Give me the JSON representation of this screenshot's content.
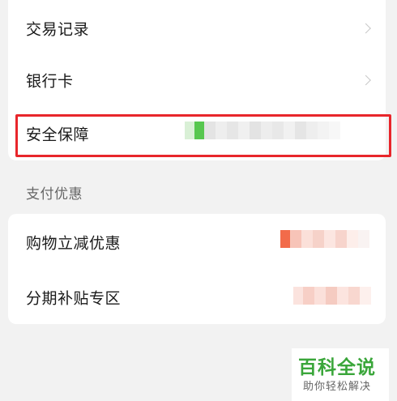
{
  "wallet": {
    "rows": [
      {
        "label": "交易记录"
      },
      {
        "label": "银行卡"
      },
      {
        "label": "安全保障"
      }
    ],
    "section_title": "支付优惠",
    "promo_rows": [
      {
        "label": "购物立减优惠"
      },
      {
        "label": "分期补贴专区"
      }
    ]
  },
  "icons": {
    "chevron": "chevron-right-icon"
  },
  "colors": {
    "highlight": "#e8262b",
    "security_accent": "#57c74f",
    "promo_accent": "#f26b4a",
    "watermark": "#3aa63a"
  },
  "watermark": {
    "title": "百科全说",
    "subtitle": "助你轻松解决"
  }
}
